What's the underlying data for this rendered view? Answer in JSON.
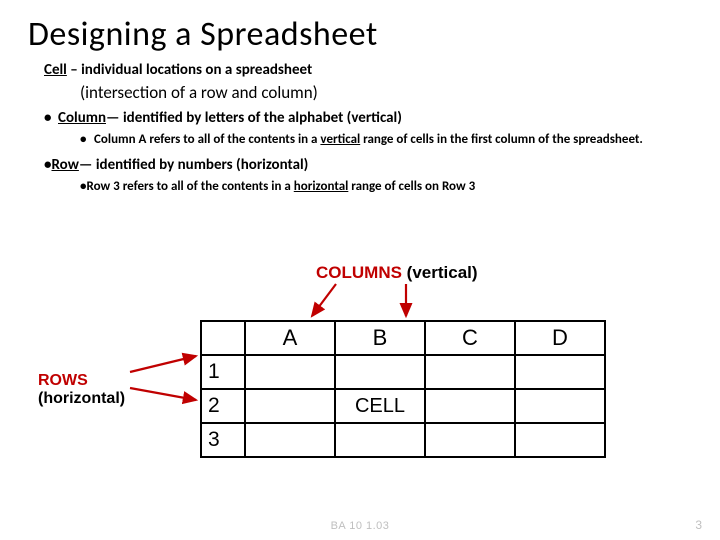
{
  "title": "Designing a Spreadsheet",
  "defs": {
    "cell_term": "Cell",
    "cell_rest": " – individual locations on a spreadsheet",
    "cell_sub": "(intersection of a row and column)",
    "column_term": "Column",
    "column_rest": "— identified by letters of the alphabet (vertical)",
    "column_sub_pre": "Column A refers to all of the contents in a ",
    "column_sub_u": "vertical",
    "column_sub_post": " range of cells in the first column of the spreadsheet.",
    "row_term": "Row",
    "row_rest": "— identified by numbers (horizontal)",
    "row_sub_pre": "Row 3 refers to all of the contents in a ",
    "row_sub_u": "horizontal",
    "row_sub_post": " range of cells on Row 3"
  },
  "diagram": {
    "columns_label": "COLUMNS",
    "columns_paren": "  (vertical)",
    "rows_label": "ROWS",
    "rows_paren": "(horizontal)",
    "col_headers": [
      "A",
      "B",
      "C",
      "D"
    ],
    "row_headers": [
      "1",
      "2",
      "3"
    ],
    "cell_text": "CELL"
  },
  "footer": {
    "code": "BA 10  1.03",
    "page": "3"
  }
}
